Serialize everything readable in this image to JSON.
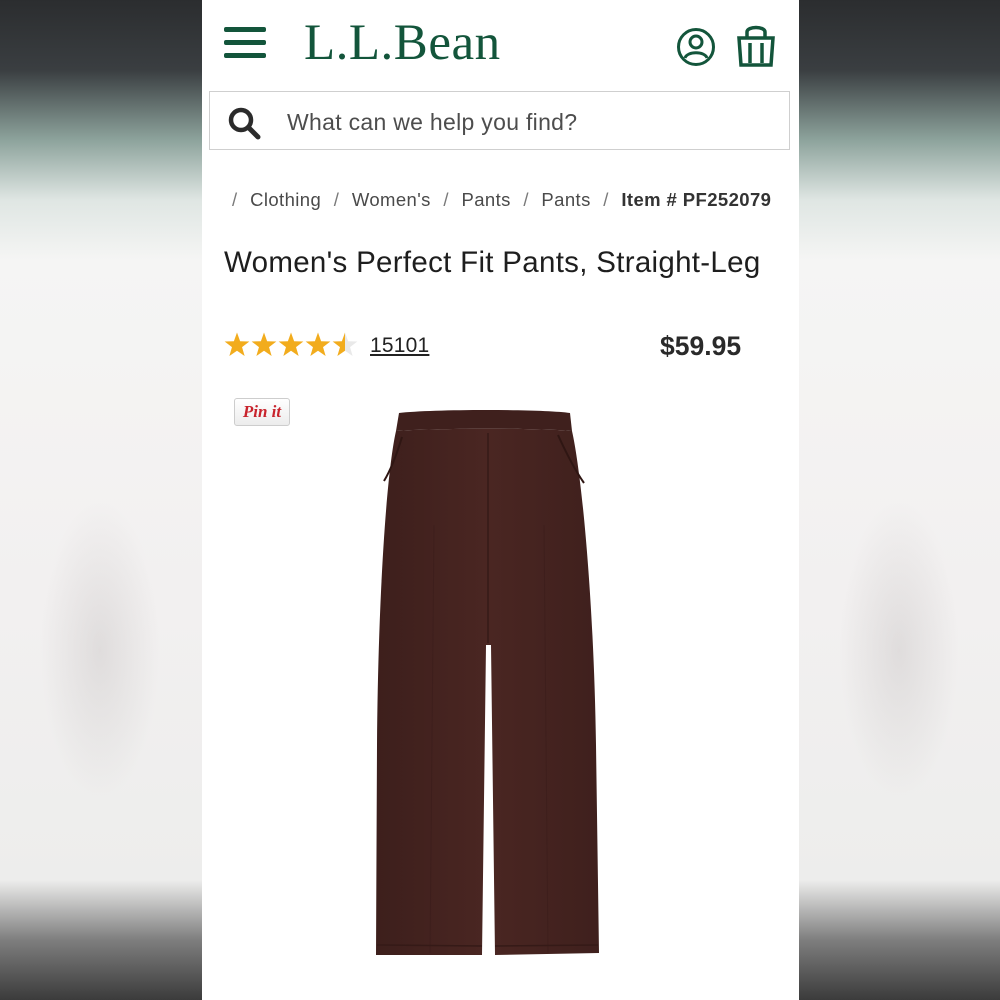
{
  "header": {
    "logo": "L.L.Bean",
    "menu_icon": "hamburger-menu-icon",
    "account_icon": "account-user-icon",
    "cart_icon": "shopping-bag-icon"
  },
  "search": {
    "icon": "search-icon",
    "placeholder": "What can we help you find?",
    "value": ""
  },
  "breadcrumb": {
    "items": [
      "Clothing",
      "Women's",
      "Pants",
      "Pants"
    ],
    "item_number": "Item # PF252079"
  },
  "product": {
    "title": "Women's Perfect Fit Pants, Straight-Leg",
    "rating": 4.5,
    "rating_max": 5,
    "review_count": "15101",
    "price": "$59.95",
    "pin_label": "Pin it",
    "image": "brown-pants-image"
  },
  "colors": {
    "brand_green": "#13553b",
    "star_gold": "#f2ac1d",
    "pants_brown": "#452320",
    "pin_red": "#c8232c"
  }
}
